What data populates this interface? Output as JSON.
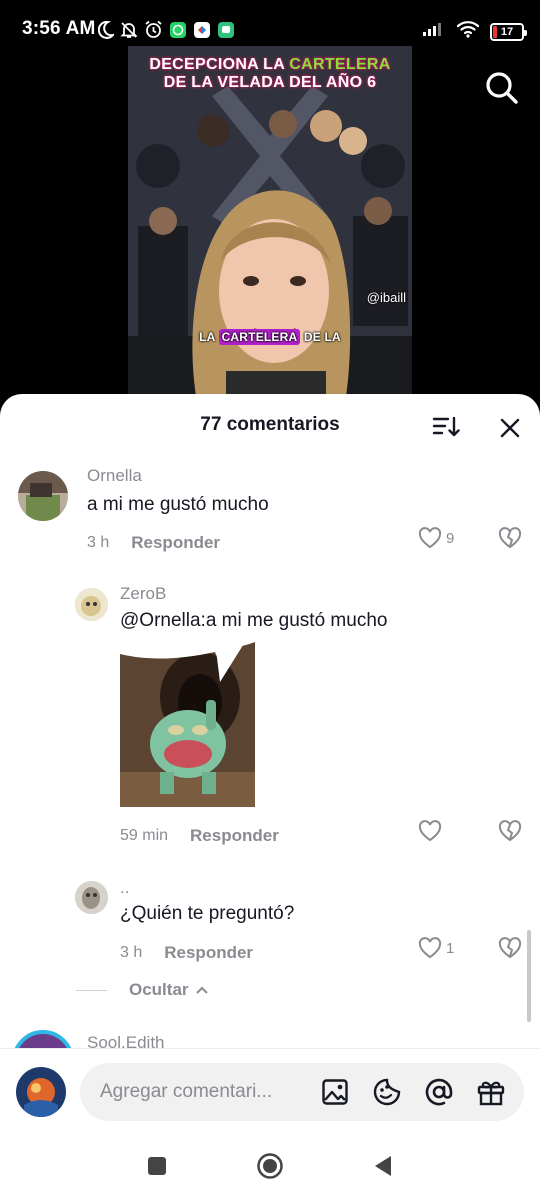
{
  "status_bar": {
    "time": "3:56 AM",
    "battery": "17"
  },
  "video": {
    "title_line1_a": "DECEPCIONA LA ",
    "title_line1_b": "CARTELERA",
    "title_line2": "DE LA VELADA DEL AÑO 6",
    "handle": "@ibaill",
    "caption_a": "LA ",
    "caption_b": "CARTELERA",
    "caption_c": " DE LA"
  },
  "comments_sheet": {
    "title": "77 comentarios",
    "comments": [
      {
        "user": "Ornella",
        "text": "a mi me gustó mucho",
        "time": "3 h",
        "reply_label": "Responder",
        "likes": "9"
      },
      {
        "user": "ZeroB",
        "text": "@Ornella:a mi me gustó mucho",
        "time": "59 min",
        "reply_label": "Responder",
        "likes": ""
      },
      {
        "user": "..",
        "text": "¿Quién te preguntó?",
        "time": "3 h",
        "reply_label": "Responder",
        "likes": "1"
      },
      {
        "user": "Sool.Edith"
      }
    ],
    "hide_label": "Ocultar"
  },
  "composer": {
    "placeholder": "Agregar comentari..."
  },
  "colors": {
    "accent_green": "#8bdd3a",
    "caption_highlight": "#b020c8",
    "battery_low": "#e53935",
    "muted_text": "#8a8b91"
  }
}
